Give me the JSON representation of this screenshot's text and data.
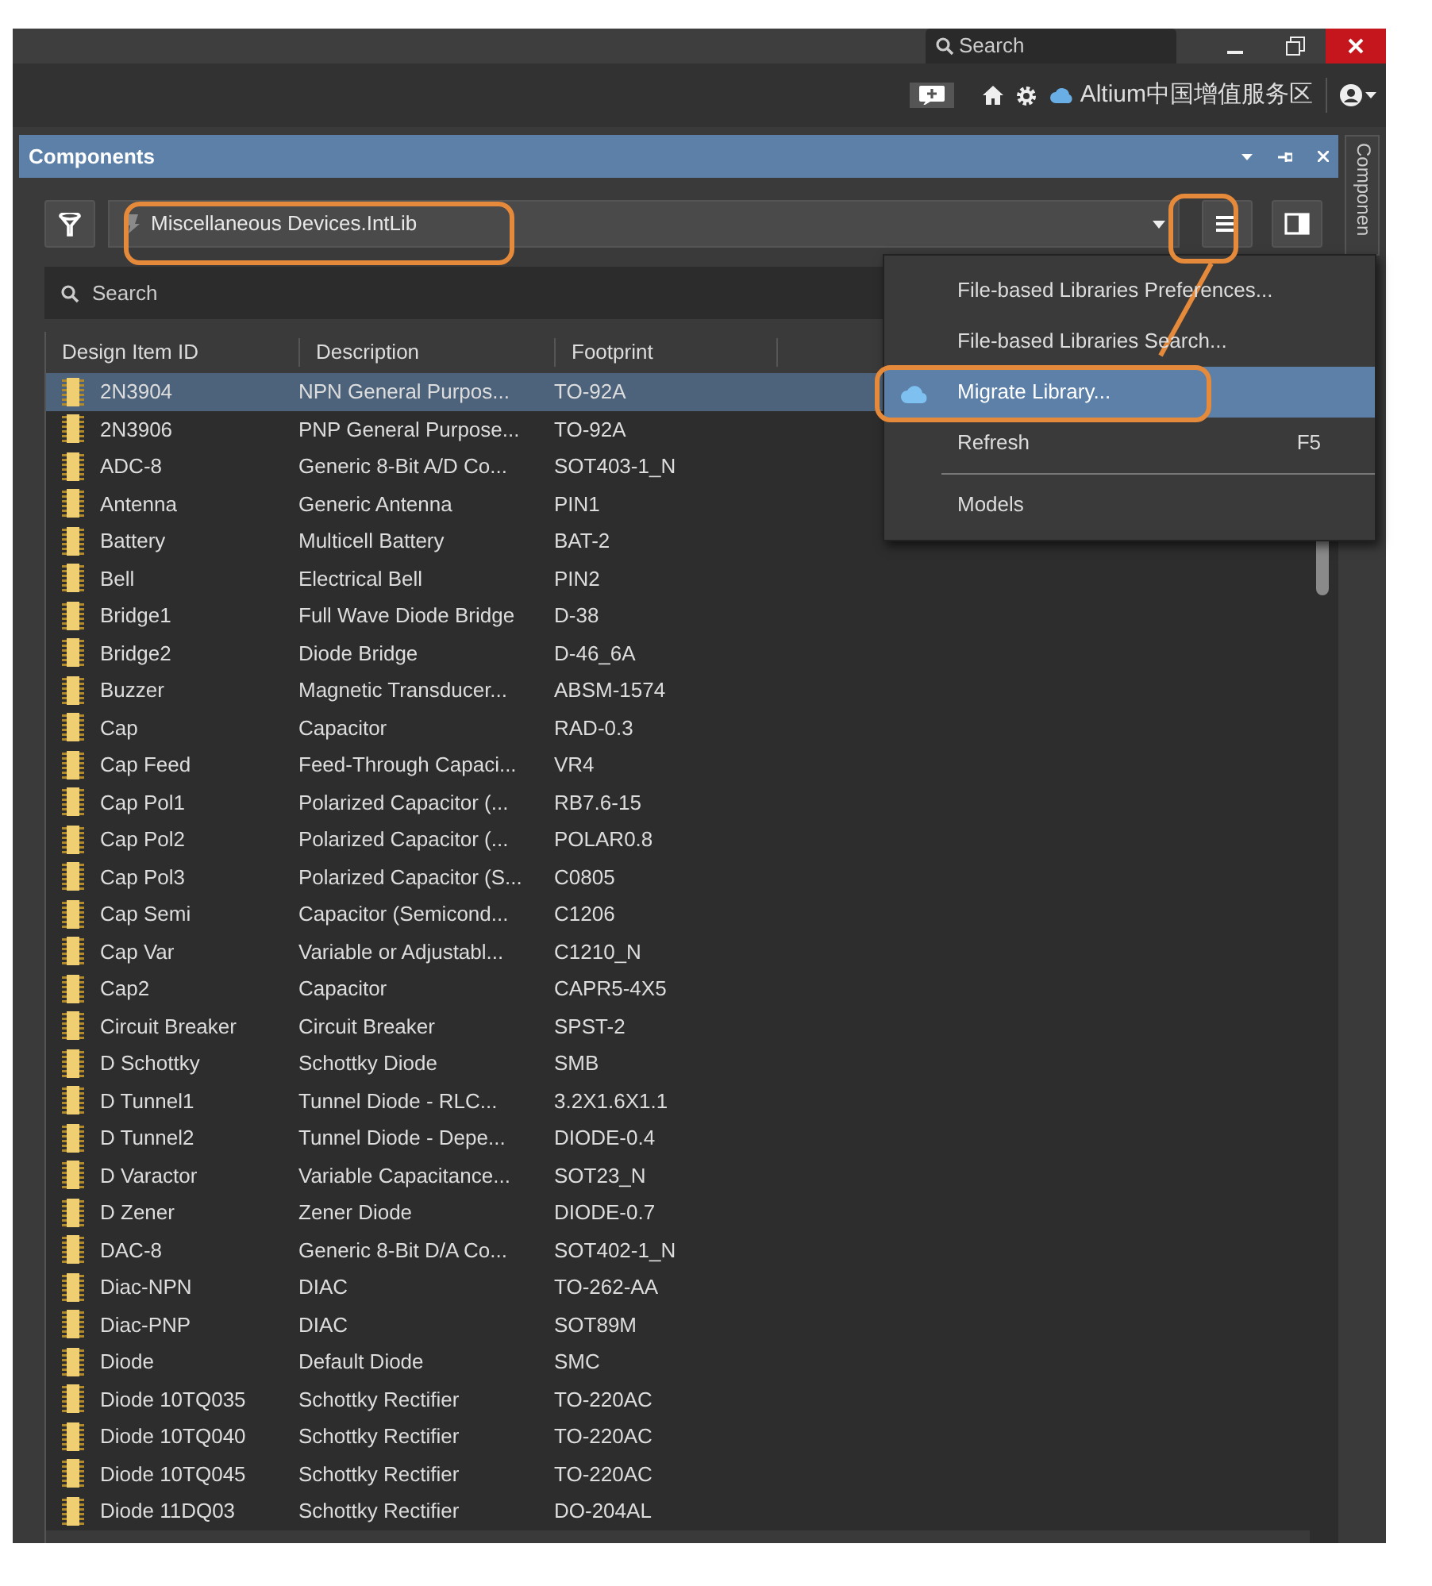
{
  "title_bar": {
    "search_placeholder": "Search"
  },
  "toolbar": {
    "workspace": "Altium中国增值服务区"
  },
  "panel": {
    "title": "Components",
    "side_tab": "Componen",
    "library": "Miscellaneous Devices.IntLib",
    "search_placeholder": "Search",
    "columns": [
      "Design Item ID",
      "Description",
      "Footprint"
    ],
    "rows": [
      {
        "id": "2N3904",
        "description": "NPN General Purpos...",
        "footprint": "TO-92A",
        "selected": true
      },
      {
        "id": "2N3906",
        "description": "PNP General Purpose...",
        "footprint": "TO-92A",
        "selected": false
      },
      {
        "id": "ADC-8",
        "description": "Generic 8-Bit A/D Co...",
        "footprint": "SOT403-1_N",
        "selected": false
      },
      {
        "id": "Antenna",
        "description": "Generic Antenna",
        "footprint": "PIN1",
        "selected": false
      },
      {
        "id": "Battery",
        "description": "Multicell Battery",
        "footprint": "BAT-2",
        "selected": false
      },
      {
        "id": "Bell",
        "description": "Electrical Bell",
        "footprint": "PIN2",
        "selected": false
      },
      {
        "id": "Bridge1",
        "description": "Full Wave Diode Bridge",
        "footprint": "D-38",
        "selected": false
      },
      {
        "id": "Bridge2",
        "description": "Diode Bridge",
        "footprint": "D-46_6A",
        "selected": false
      },
      {
        "id": "Buzzer",
        "description": "Magnetic Transducer...",
        "footprint": "ABSM-1574",
        "selected": false
      },
      {
        "id": "Cap",
        "description": "Capacitor",
        "footprint": "RAD-0.3",
        "selected": false
      },
      {
        "id": "Cap Feed",
        "description": "Feed-Through Capaci...",
        "footprint": "VR4",
        "selected": false
      },
      {
        "id": "Cap Pol1",
        "description": "Polarized Capacitor (...",
        "footprint": "RB7.6-15",
        "selected": false
      },
      {
        "id": "Cap Pol2",
        "description": "Polarized Capacitor (...",
        "footprint": "POLAR0.8",
        "selected": false
      },
      {
        "id": "Cap Pol3",
        "description": "Polarized Capacitor (S...",
        "footprint": "C0805",
        "selected": false
      },
      {
        "id": "Cap Semi",
        "description": "Capacitor (Semicond...",
        "footprint": "C1206",
        "selected": false
      },
      {
        "id": "Cap Var",
        "description": "Variable or Adjustabl...",
        "footprint": "C1210_N",
        "selected": false
      },
      {
        "id": "Cap2",
        "description": "Capacitor",
        "footprint": "CAPR5-4X5",
        "selected": false
      },
      {
        "id": "Circuit Breaker",
        "description": "Circuit Breaker",
        "footprint": "SPST-2",
        "selected": false
      },
      {
        "id": "D Schottky",
        "description": "Schottky Diode",
        "footprint": "SMB",
        "selected": false
      },
      {
        "id": "D Tunnel1",
        "description": "Tunnel Diode - RLC...",
        "footprint": "3.2X1.6X1.1",
        "selected": false
      },
      {
        "id": "D Tunnel2",
        "description": "Tunnel Diode - Depe...",
        "footprint": "DIODE-0.4",
        "selected": false
      },
      {
        "id": "D Varactor",
        "description": "Variable Capacitance...",
        "footprint": "SOT23_N",
        "selected": false
      },
      {
        "id": "D Zener",
        "description": "Zener Diode",
        "footprint": "DIODE-0.7",
        "selected": false
      },
      {
        "id": "DAC-8",
        "description": "Generic 8-Bit D/A Co...",
        "footprint": "SOT402-1_N",
        "selected": false
      },
      {
        "id": "Diac-NPN",
        "description": "DIAC",
        "footprint": "TO-262-AA",
        "selected": false
      },
      {
        "id": "Diac-PNP",
        "description": "DIAC",
        "footprint": "SOT89M",
        "selected": false
      },
      {
        "id": "Diode",
        "description": "Default Diode",
        "footprint": "SMC",
        "selected": false
      },
      {
        "id": "Diode 10TQ035",
        "description": "Schottky Rectifier",
        "footprint": "TO-220AC",
        "selected": false
      },
      {
        "id": "Diode 10TQ040",
        "description": "Schottky Rectifier",
        "footprint": "TO-220AC",
        "selected": false
      },
      {
        "id": "Diode 10TQ045",
        "description": "Schottky Rectifier",
        "footprint": "TO-220AC",
        "selected": false
      },
      {
        "id": "Diode 11DQ03",
        "description": "Schottky Rectifier",
        "footprint": "DO-204AL",
        "selected": false
      }
    ]
  },
  "menu": [
    {
      "label": "File-based Libraries Preferences...",
      "selected": false,
      "divider_after": false
    },
    {
      "label": "File-based Libraries Search...",
      "selected": false,
      "divider_after": false
    },
    {
      "label": "Migrate Library...",
      "selected": true,
      "kind": "cloud",
      "divider_after": false
    },
    {
      "label": "Refresh",
      "shortcut": "F5",
      "selected": false,
      "divider_after": true
    },
    {
      "label": "Models",
      "selected": false,
      "divider_after": false
    }
  ]
}
